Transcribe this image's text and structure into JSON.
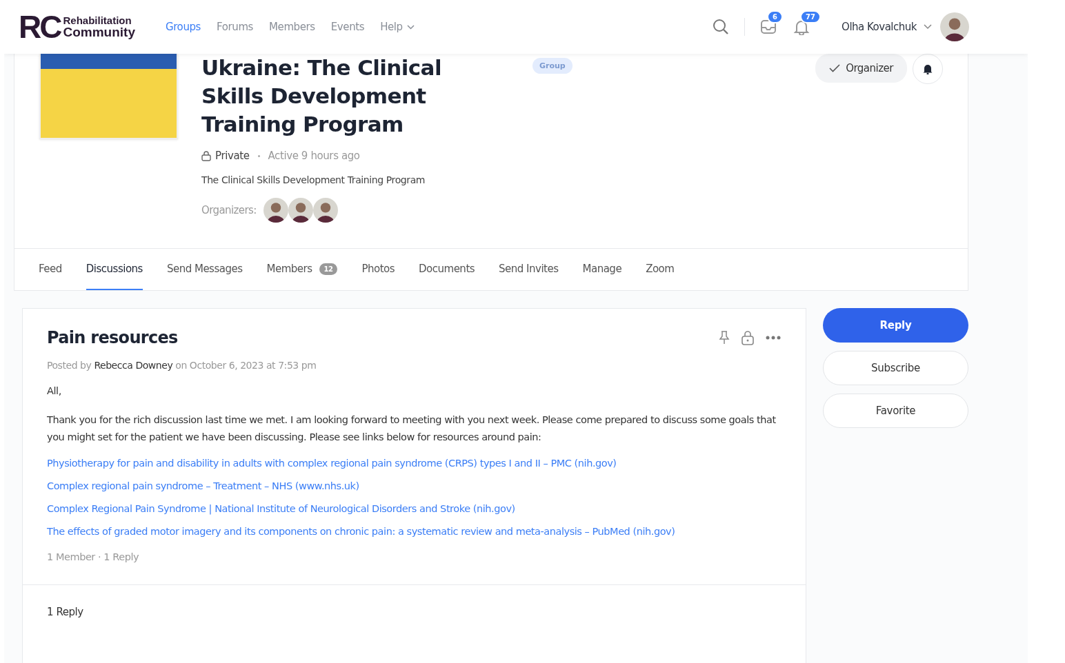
{
  "header": {
    "logo": {
      "mark": "RC",
      "line1": "Rehabilitation",
      "line2": "Community"
    },
    "nav": [
      {
        "label": "Groups",
        "selected": true,
        "kind": "link"
      },
      {
        "label": "Forums",
        "selected": false,
        "kind": "link"
      },
      {
        "label": "Members",
        "selected": false,
        "kind": "link"
      },
      {
        "label": "Events",
        "selected": false,
        "kind": "link"
      },
      {
        "label": "Help",
        "selected": false,
        "kind": "dropdown"
      }
    ],
    "messages_count": "6",
    "notifications_count": "77",
    "user_name": "Olha Kovalchuk"
  },
  "group": {
    "title": "Ukraine: The Clinical Skills Development Training Program",
    "badge": "Group",
    "privacy": "Private",
    "activity": "Active 9 hours ago",
    "description": "The Clinical Skills Development Training Program",
    "organizers_label": "Organizers:",
    "organizer_button": "Organizer"
  },
  "tabs": [
    {
      "label": "Feed",
      "selected": false
    },
    {
      "label": "Discussions",
      "selected": true
    },
    {
      "label": "Send Messages",
      "selected": false
    },
    {
      "label": "Members",
      "selected": false,
      "count": "12"
    },
    {
      "label": "Photos",
      "selected": false
    },
    {
      "label": "Documents",
      "selected": false
    },
    {
      "label": "Send Invites",
      "selected": false
    },
    {
      "label": "Manage",
      "selected": false
    },
    {
      "label": "Zoom",
      "selected": false
    }
  ],
  "post": {
    "title": "Pain resources",
    "posted_by": "Posted by",
    "author": "Rebecca Downey",
    "date": "on October 6, 2023 at 7:53 pm",
    "greeting": "All,",
    "body": "Thank you for the rich discussion last time we met. I am looking forward to meeting with you next week. Please come prepared to discuss some goals that you might set for the patient we have been discussing. Please see links below for resources around pain:",
    "links": [
      "Physiotherapy for pain and disability in adults with complex regional pain syndrome (CRPS) types I and II – PMC (nih.gov)",
      "Complex regional pain syndrome – Treatment – NHS (www.nhs.uk)",
      "Complex Regional Pain Syndrome | National Institute of Neurological Disorders and Stroke (nih.gov)",
      "The effects of graded motor imagery and its components on chronic pain: a systematic review and meta-analysis – PubMed (nih.gov)"
    ],
    "meta": "1 Member · 1 Reply",
    "replies_heading": "1 Reply"
  },
  "actions": [
    {
      "label": "Reply",
      "kind": "primary"
    },
    {
      "label": "Subscribe",
      "kind": "secondary"
    },
    {
      "label": "Favorite",
      "kind": "secondary"
    }
  ]
}
